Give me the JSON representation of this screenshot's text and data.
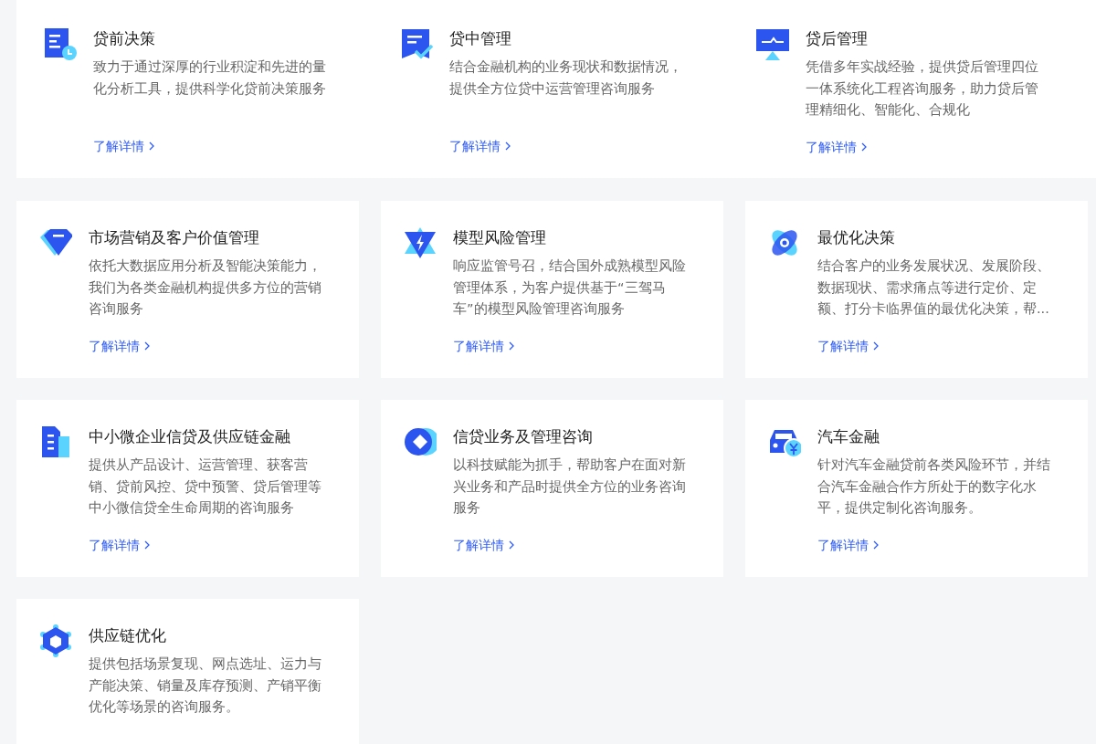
{
  "top_panel": {
    "cards": [
      {
        "title": "贷前决策",
        "description": "致力于通过深厚的行业积淀和先进的量化分析工具，提供科学化贷前决策服务",
        "link": "了解详情"
      },
      {
        "title": "贷中管理",
        "description": "结合金融机构的业务现状和数据情况，提供全方位贷中运营管理咨询服务",
        "link": "了解详情"
      },
      {
        "title": "贷后管理",
        "description": "凭借多年实战经验，提供贷后管理四位一体系统化工程咨询服务，助力贷后管理精细化、智能化、合规化",
        "link": "了解详情"
      }
    ]
  },
  "cards": [
    {
      "title": "市场营销及客户价值管理",
      "description": "依托大数据应用分析及智能决策能力，我们为各类金融机构提供多方位的营销咨询服务",
      "link": "了解详情"
    },
    {
      "title": "模型风险管理",
      "description": "响应监管号召，结合国外成熟模型风险管理体系，为客户提供基于“三驾马车”的模型风险管理咨询服务",
      "link": "了解详情"
    },
    {
      "title": "最优化决策",
      "description": "结合客户的业务发展状况、发展阶段、数据现状、需求痛点等进行定价、定额、打分卡临界值的最优化决策，帮...",
      "link": "了解详情"
    },
    {
      "title": "中小微企业信贷及供应链金融",
      "description": "提供从产品设计、运营管理、获客营销、贷前风控、贷中预警、贷后管理等中小微信贷全生命周期的咨询服务",
      "link": "了解详情"
    },
    {
      "title": "信贷业务及管理咨询",
      "description": "以科技赋能为抓手，帮助客户在面对新兴业务和产品时提供全方位的业务咨询服务",
      "link": "了解详情"
    },
    {
      "title": "汽车金融",
      "description": "针对汽车金融贷前各类风险环节，并结合汽车金融合作方所处于的数字化水平，提供定制化咨询服务。",
      "link": "了解详情"
    },
    {
      "title": "供应链优化",
      "description": "提供包括场景复现、网点选址、运力与产能决策、销量及库存预测、产销平衡优化等场景的咨询服务。"
    }
  ]
}
